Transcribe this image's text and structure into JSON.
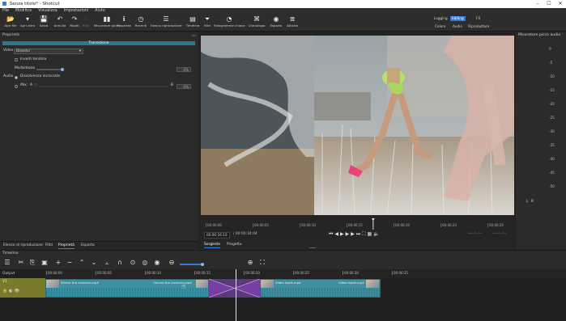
{
  "window": {
    "title": "Senza titolo* - Shotcut",
    "controls": [
      "–",
      "☐",
      "✕"
    ]
  },
  "menu": [
    "File",
    "Modifica",
    "Visualizza",
    "Impostazioni",
    "Aiuto"
  ],
  "toolbar": [
    {
      "label": "Apri file",
      "icon": "folder-icon",
      "glyph": "📂"
    },
    {
      "label": "Apri altro",
      "icon": "open-other-icon",
      "glyph": "▾"
    },
    {
      "label": "Salva",
      "icon": "save-icon",
      "glyph": "💾"
    },
    {
      "label": "Annulla",
      "icon": "undo-icon",
      "glyph": "↶"
    },
    {
      "label": "Ripeti",
      "icon": "redo-icon",
      "glyph": "↷"
    },
    {
      "label": "Rifai",
      "icon": "redo-disabled-icon",
      "glyph": "·"
    },
    {
      "label": "Misuratore picco",
      "icon": "peak-meter-icon",
      "glyph": "▮▮"
    },
    {
      "label": "Proprietà",
      "icon": "properties-icon",
      "glyph": "ℹ"
    },
    {
      "label": "Recenti",
      "icon": "recent-icon",
      "glyph": "◷"
    },
    {
      "label": "Elenco riproduzione",
      "icon": "playlist-icon",
      "glyph": "☰"
    },
    {
      "label": "Timeline",
      "icon": "timeline-icon",
      "glyph": "▤"
    },
    {
      "label": "Filtri",
      "icon": "filter-icon",
      "glyph": "⏷"
    },
    {
      "label": "Fotogramme chiave",
      "icon": "keyframes-icon",
      "glyph": "◔"
    },
    {
      "label": "Cronologia",
      "icon": "history-icon",
      "glyph": "⌘"
    },
    {
      "label": "Esporta",
      "icon": "export-icon",
      "glyph": "◉"
    },
    {
      "label": "Attività",
      "icon": "jobs-icon",
      "glyph": "≣"
    }
  ],
  "layouts": {
    "top": [
      "Logging",
      "Editing",
      "FX"
    ],
    "bottom": [
      "Colore",
      "Audio",
      "Riproduttore"
    ],
    "active": "Editing"
  },
  "properties": {
    "panel_title": "Proprietà",
    "transition_label": "Transizione",
    "video_label": "Video",
    "video_value": "Dissolvi",
    "invert_label": "Inverti tendina",
    "softness_label": "Morbidezza",
    "softness_value": "0%",
    "softness_fraction": 0.0,
    "audio_label": "Audio",
    "crossfade_label": "Dissolvenza incrociata",
    "mix_label": "Mix:",
    "mix_a": "A",
    "mix_b": "B",
    "mix_value": "0%"
  },
  "bottom_tabs": [
    "Elenco di riproduzione",
    "Filtri",
    "Proprietà",
    "Esporta"
  ],
  "viewer": {
    "ruler_ticks": [
      "00:00:00",
      "00:00:05",
      "00:00:10",
      "00:00:15",
      "00:00:19",
      "00:00:24",
      "00:00:29"
    ],
    "current_time": "00:00:16:10",
    "total_time": "/ 00:00:34:04",
    "right_tc1": "--:--:--:--",
    "right_tc2": "--:--:--:--",
    "playhead_fraction": 0.55
  },
  "source_tabs": [
    "Sorgente",
    "Progetto"
  ],
  "meter": {
    "title": "Misuratore picco audio",
    "scale": [
      "0",
      "-5",
      "-10",
      "-15",
      "-20",
      "-25",
      "-30",
      "-35",
      "-40",
      "-45",
      "-50"
    ],
    "channels": [
      "L",
      "R"
    ]
  },
  "timeline": {
    "title": "Timeline",
    "output_label": "Output",
    "track_label": "V1",
    "ruler": [
      "00:00:00",
      "00:00:05",
      "00:00:10",
      "00:00:15",
      "00:00:20",
      "00:00:25",
      "00:00:30",
      "00:00:35"
    ],
    "clips": [
      "Winter the cannons.mp4",
      "Dunno the cannons.mp4",
      "Video Isaak.mp4",
      "Video Isaak.mp4"
    ]
  },
  "colors": {
    "accent": "#3a7bd5",
    "clip": "#3e8fa0",
    "transition": "#7a3fa8",
    "track_head": "#7a7a2b"
  }
}
